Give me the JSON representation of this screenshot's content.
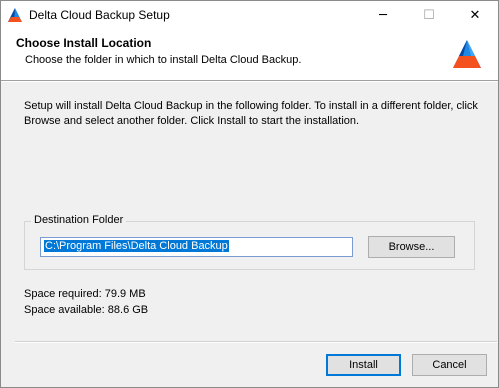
{
  "window": {
    "title": "Delta Cloud Backup Setup",
    "icon": "delta-logo-icon",
    "controls": {
      "minimize": "─",
      "maximize": "☐",
      "close": "✕"
    }
  },
  "header": {
    "title": "Choose Install Location",
    "subtitle": "Choose the folder in which to install Delta Cloud Backup."
  },
  "main": {
    "intro": "Setup will install Delta Cloud Backup in the following folder. To install in a different folder, click Browse and select another folder. Click Install to start the installation.",
    "destination": {
      "group_label": "Destination Folder",
      "path": "C:\\Program Files\\Delta Cloud Backup",
      "browse_label": "Browse..."
    },
    "space_required": "Space required: 79.9 MB",
    "space_available": "Space available: 88.6 GB"
  },
  "footer": {
    "install_label": "Install",
    "cancel_label": "Cancel"
  },
  "colors": {
    "logo_blue": "#1e88e5",
    "logo_orange": "#f4511e",
    "selection": "#0078d7"
  }
}
